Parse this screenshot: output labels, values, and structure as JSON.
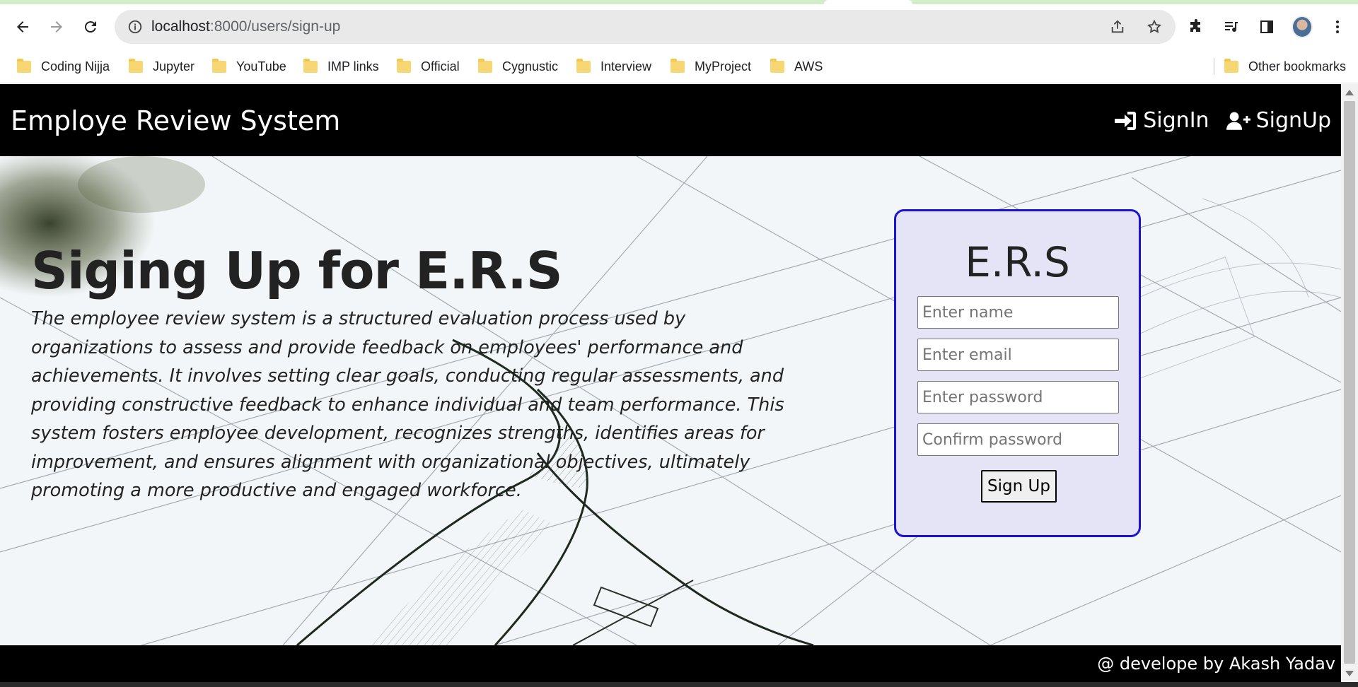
{
  "browser": {
    "url_host": "localhost",
    "url_path": ":8000/users/sign-up",
    "bookmarks": [
      "Coding Nijja",
      "Jupyter",
      "YouTube",
      "IMP links",
      "Official",
      "Cygnustic",
      "Interview",
      "MyProject",
      "AWS"
    ],
    "other_bookmarks": "Other bookmarks"
  },
  "navbar": {
    "brand": "Employe Review System",
    "signin_label": "SignIn",
    "signup_label": "SignUp"
  },
  "hero": {
    "title": "Siging Up for E.R.S",
    "description": "The employee review system is a structured evaluation process used by organizations to assess and provide feedback on employees' performance and achievements. It involves setting clear goals, conducting regular assessments, and providing constructive feedback to enhance individual and team performance. This system fosters employee development, recognizes strengths, identifies areas for improvement, and ensures alignment with organizational objectives, ultimately promoting a more productive and engaged workforce."
  },
  "form": {
    "title": "E.R.S",
    "name_placeholder": "Enter name",
    "email_placeholder": "Enter email",
    "password_placeholder": "Enter password",
    "confirm_placeholder": "Confirm password",
    "submit_label": "Sign Up",
    "accent_color": "#1c12d6",
    "background_color": "#e5e4f7"
  },
  "footer": {
    "text": "@ develope by Akash Yadav"
  }
}
